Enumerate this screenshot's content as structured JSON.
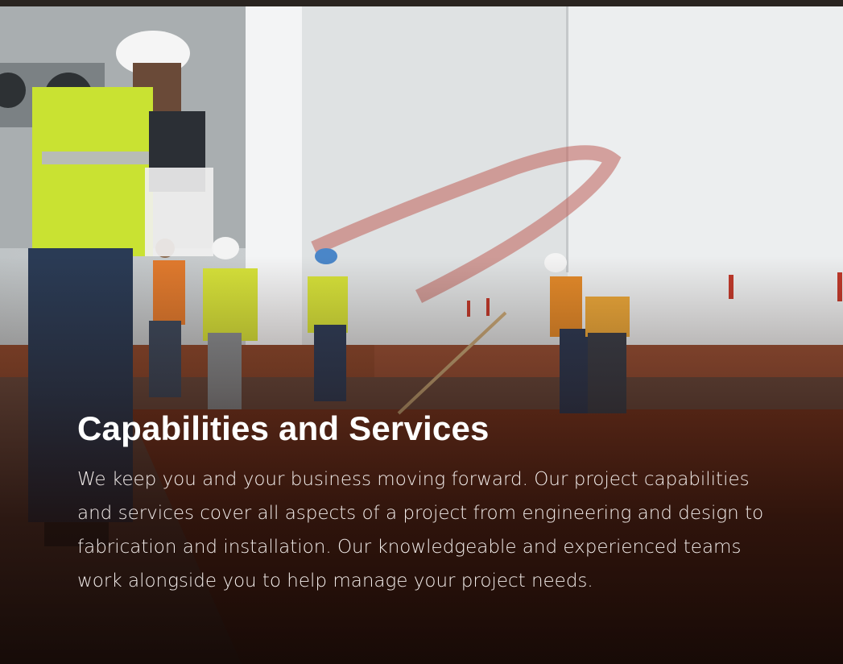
{
  "hero": {
    "image_description_icon": "construction-workers-photo",
    "title": "Capabilities and Services",
    "description": "We keep you and your business moving forward. Our project capabilities and services cover all aspects of a project from engineering and design to fabrication and installation. Our knowledgeable and experienced teams work alongside you to help manage your project needs."
  },
  "colors": {
    "background": "#1c1410",
    "text": "#ffffff",
    "floor_coating": "#8a3b1f",
    "vest": "#c8e33a"
  }
}
